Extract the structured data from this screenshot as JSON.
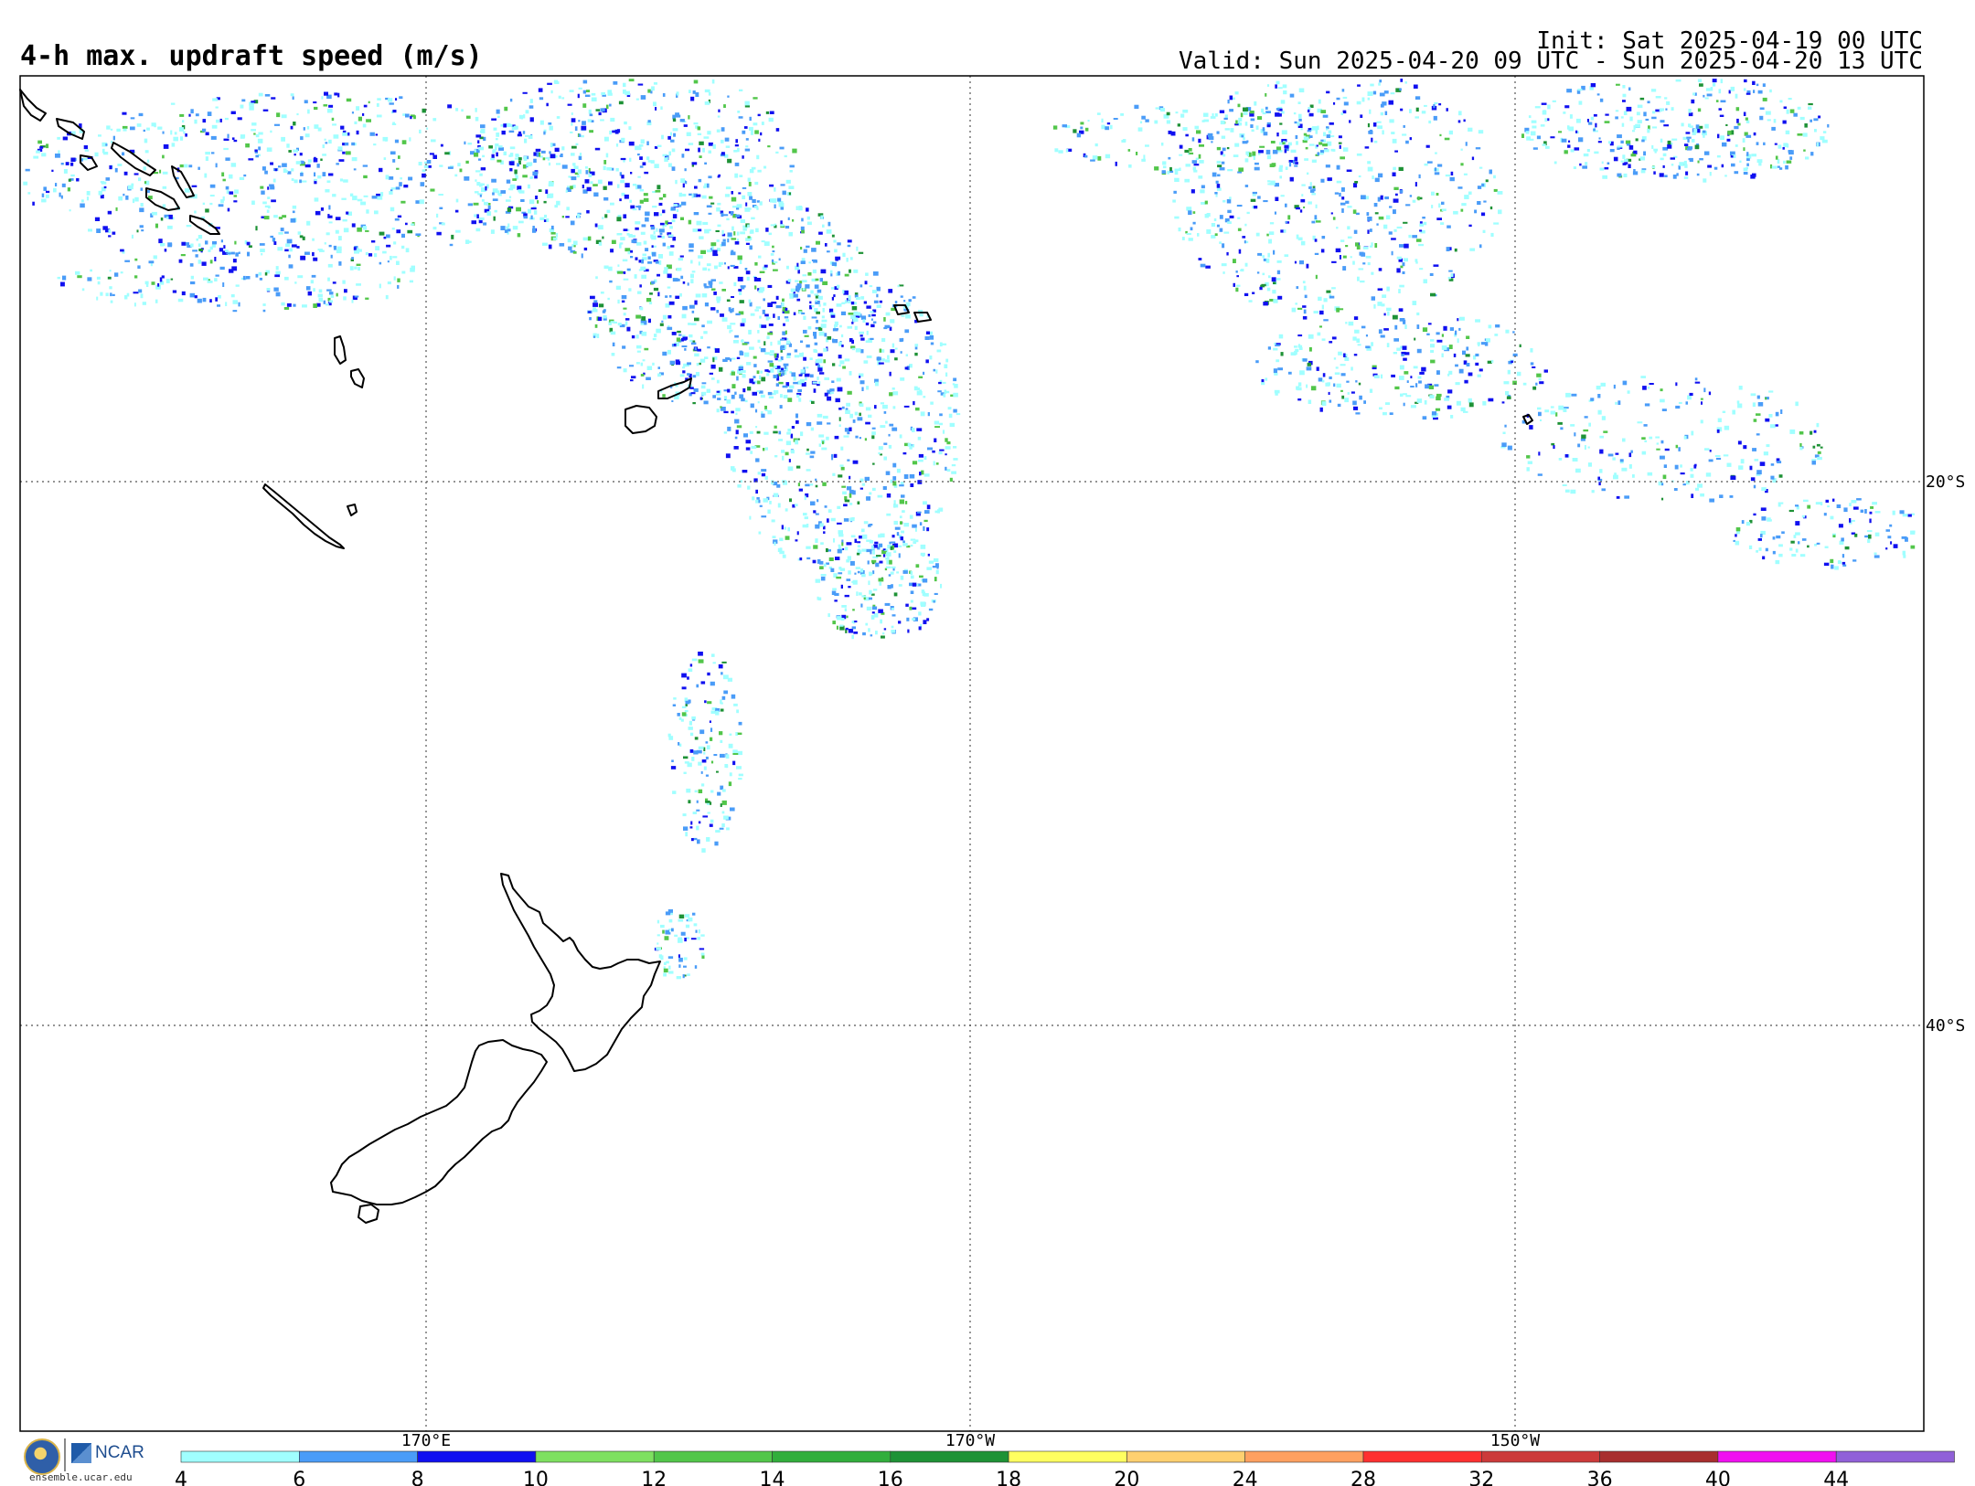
{
  "title": "4-h max. updraft speed (m/s)",
  "init_text": "Init: Sat 2025-04-19 00 UTC",
  "valid_text": "Valid: Sun 2025-04-20 09 UTC - Sun 2025-04-20 13 UTC",
  "map": {
    "longitude_labels": [
      "170°E",
      "170°W",
      "150°W"
    ],
    "latitude_labels": [
      "20°S",
      "40°S"
    ],
    "units": "m/s"
  },
  "colorbar": {
    "ticks": [
      "4",
      "6",
      "8",
      "10",
      "12",
      "14",
      "16",
      "18",
      "20",
      "24",
      "28",
      "32",
      "36",
      "40",
      "44"
    ],
    "colors": [
      "#a0ffff",
      "#4a9cf8",
      "#1010f0",
      "#7ee060",
      "#52c64a",
      "#32ae3c",
      "#1e9236",
      "#ffff60",
      "#ffd070",
      "#ffa060",
      "#ff3030",
      "#cc3a3a",
      "#a82e2e",
      "#f010f0",
      "#9060d8"
    ]
  },
  "logo": {
    "org": "NCAR",
    "url": "ensemble.ucar.edu"
  },
  "colors": {
    "coast": "#000000",
    "grid": "#555555"
  }
}
